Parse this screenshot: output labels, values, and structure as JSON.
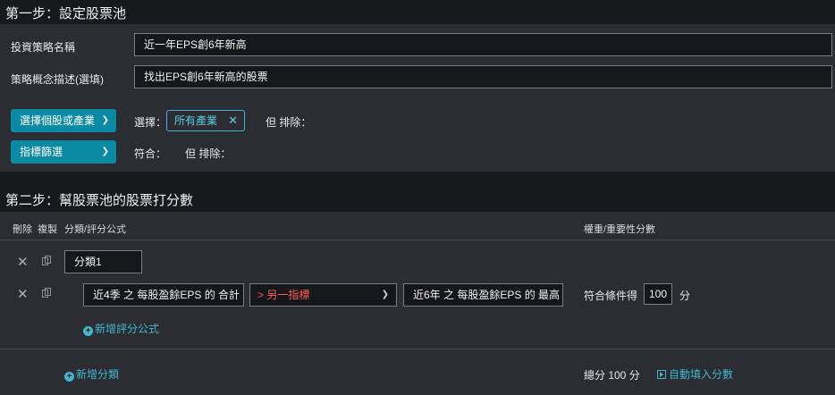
{
  "step1": {
    "title": "第一步：設定股票池",
    "strategy_name_label": "投資策略名稱",
    "strategy_name_value": "近一年EPS創6年新高",
    "strategy_desc_label": "策略概念描述(選填)",
    "strategy_desc_value": "找出EPS創6年新高的股票",
    "select_stock_button": "選擇個股或產業",
    "select_label": "選擇：",
    "selected_tag": "所有產業",
    "exclude_label_1": "但 排除：",
    "filter_button": "指標篩選",
    "match_label": "符合：",
    "exclude_label_2": "但 排除："
  },
  "step2": {
    "title": "第二步：幫股票池的股票打分數",
    "headers": {
      "delete": "刪除",
      "copy": "複製",
      "formula": "分類/評分公式",
      "weight": "權重/重要性分數"
    },
    "category_name": "分類1",
    "formula": {
      "left": "近4季 之 每股盈餘EPS 的 合計",
      "operator": "> 另一指標",
      "right": "近6年 之 每股盈餘EPS 的 最高",
      "score_prefix": "符合條件得",
      "score_value": "100",
      "score_unit": "分"
    },
    "add_formula_link": "新增評分公式",
    "add_category_link": "新增分類",
    "total_label": "總分 100 分",
    "auto_fill_link": "自動填入分數"
  }
}
